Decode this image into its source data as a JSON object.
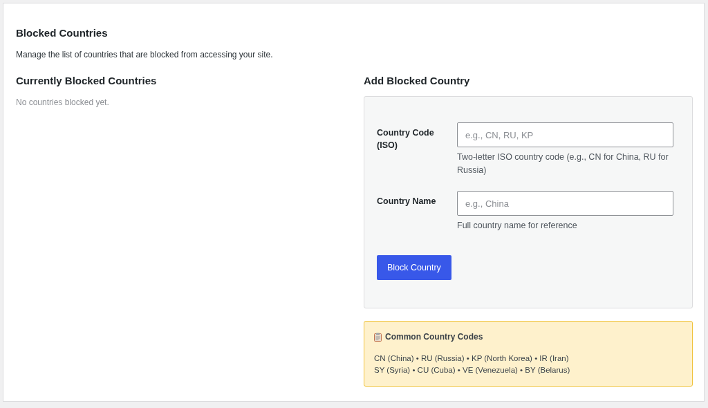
{
  "title": "Blocked Countries",
  "description": "Manage the list of countries that are blocked from accessing your site.",
  "blocked": {
    "heading": "Currently Blocked Countries",
    "empty_text": "No countries blocked yet."
  },
  "add": {
    "heading": "Add Blocked Country",
    "fields": [
      {
        "label": "Country Code (ISO)",
        "placeholder": "e.g., CN, RU, KP",
        "help": "Two-letter ISO country code (e.g., CN for China, RU for Russia)"
      },
      {
        "label": "Country Name",
        "placeholder": "e.g., China",
        "help": "Full country name for reference"
      }
    ],
    "button": "Block Country"
  },
  "common_codes": {
    "heading": "Common Country Codes",
    "lines": [
      "CN (China) • RU (Russia) • KP (North Korea) • IR (Iran)",
      "SY (Syria) • CU (Cuba) • VE (Venezuela) • BY (Belarus)"
    ]
  }
}
